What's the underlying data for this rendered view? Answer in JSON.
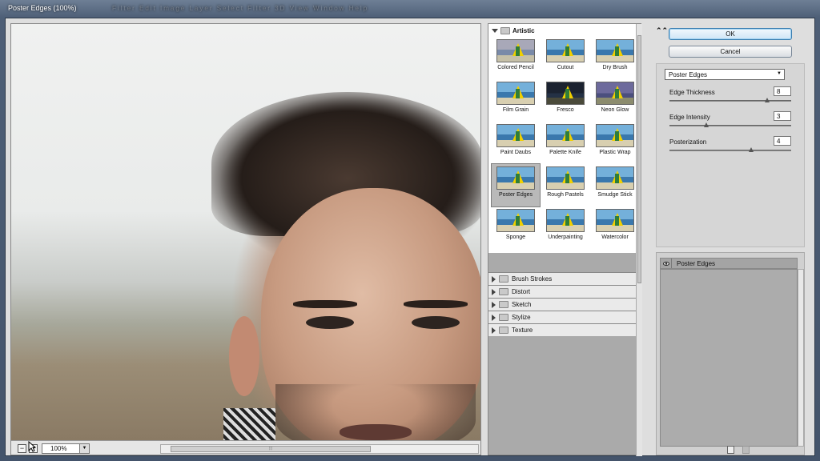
{
  "window": {
    "title": "Poster Edges (100%)",
    "menu_ghost": "Filter   Edit   Image   Layer   Select   Filter   3D   View   Window   Help"
  },
  "preview": {
    "zoom_value": "100%",
    "zoom_out_glyph": "−",
    "zoom_in_glyph": "+",
    "scroll_grip": "⦙⦙⦙",
    "scroll_position": 0.03
  },
  "gallery": {
    "open_category": "Artistic",
    "filters": [
      {
        "label": "Colored Pencil",
        "style": "color"
      },
      {
        "label": "Cutout",
        "style": "normal"
      },
      {
        "label": "Dry Brush",
        "style": "normal"
      },
      {
        "label": "Film Grain",
        "style": "normal"
      },
      {
        "label": "Fresco",
        "style": "dark"
      },
      {
        "label": "Neon Glow",
        "style": "neon"
      },
      {
        "label": "Paint Daubs",
        "style": "normal"
      },
      {
        "label": "Palette Knife",
        "style": "normal"
      },
      {
        "label": "Plastic Wrap",
        "style": "normal"
      },
      {
        "label": "Poster Edges",
        "style": "normal",
        "selected": true
      },
      {
        "label": "Rough Pastels",
        "style": "normal"
      },
      {
        "label": "Smudge Stick",
        "style": "normal"
      },
      {
        "label": "Sponge",
        "style": "normal"
      },
      {
        "label": "Underpainting",
        "style": "normal"
      },
      {
        "label": "Watercolor",
        "style": "normal"
      }
    ],
    "categories": [
      "Brush Strokes",
      "Distort",
      "Sketch",
      "Stylize",
      "Texture"
    ]
  },
  "buttons": {
    "ok": "OK",
    "cancel": "Cancel",
    "collapse_glyph": "⌃⌃"
  },
  "settings": {
    "filter_select": "Poster Edges",
    "params": [
      {
        "label": "Edge Thickness",
        "value": "8",
        "slider_fraction": 0.8
      },
      {
        "label": "Edge Intensity",
        "value": "3",
        "slider_fraction": 0.3
      },
      {
        "label": "Posterization",
        "value": "4",
        "slider_fraction": 0.67
      }
    ]
  },
  "layers": {
    "items": [
      {
        "name": "Poster Edges",
        "visible": true
      }
    ]
  },
  "colors": {
    "accent": "#3c7fb1",
    "window_frame": "#4e5f77",
    "panel_bg": "#dedede"
  }
}
